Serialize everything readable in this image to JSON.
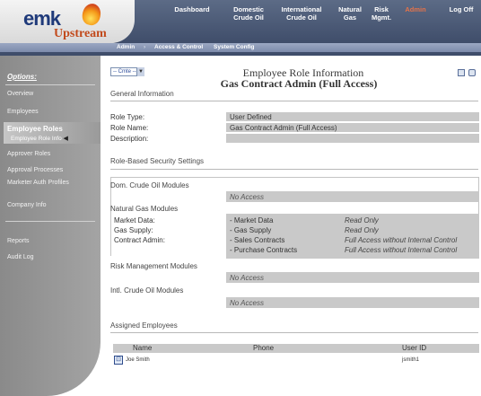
{
  "logo": {
    "brand": "emk",
    "product": "Upstream"
  },
  "topnav": [
    {
      "label": "Dashboard"
    },
    {
      "label": "Domestic Crude Oil"
    },
    {
      "label": "International Crude Oil"
    },
    {
      "label": "Natural Gas"
    },
    {
      "label": "Risk Mgmt."
    },
    {
      "label": "Admin"
    },
    {
      "label": "Log Off"
    }
  ],
  "subnav": [
    {
      "label": "Admin"
    },
    {
      "label": "Access & Control"
    },
    {
      "label": "System Config"
    }
  ],
  "sidebar": {
    "heading": "Options:",
    "items": [
      {
        "label": "Overview"
      },
      {
        "label": "Employees"
      },
      {
        "label": "Employee Roles"
      },
      {
        "label": "Employee Role Info"
      },
      {
        "label": "Approver Roles"
      },
      {
        "label": "Approval Processes"
      },
      {
        "label": "Marketer Auth Profiles"
      },
      {
        "label": "Company Info"
      },
      {
        "label": "Reports"
      },
      {
        "label": "Audit Log"
      }
    ]
  },
  "crude_select": {
    "value": "-- Cmte --"
  },
  "page": {
    "title": "Employee Role Information",
    "subtitle": "Gas Contract Admin (Full Access)"
  },
  "general": {
    "heading": "General Information",
    "role_type_label": "Role Type:",
    "role_type_value": "User Defined",
    "role_name_label": "Role Name:",
    "role_name_value": "Gas Contract Admin (Full Access)",
    "description_label": "Description:",
    "description_value": ""
  },
  "security": {
    "heading": "Role-Based Security Settings",
    "dom_crude": {
      "heading": "Dom. Crude Oil Modules",
      "value": "No Access"
    },
    "nat_gas": {
      "heading": "Natural Gas Modules",
      "rows": [
        {
          "label": "Market Data:",
          "module": "- Market Data",
          "access": "Read Only"
        },
        {
          "label": "Gas Supply:",
          "module": "- Gas Supply",
          "access": "Read Only"
        },
        {
          "label": "Contract Admin:",
          "module": "- Sales Contracts",
          "access": "Full Access without Internal Control"
        },
        {
          "label": "",
          "module": "- Purchase Contracts",
          "access": "Full Access without Internal Control"
        }
      ]
    },
    "risk": {
      "heading": "Risk Management Modules",
      "value": "No Access"
    },
    "intl": {
      "heading": "Intl. Crude Oil Modules",
      "value": "No Access"
    }
  },
  "assigned": {
    "heading": "Assigned Employees",
    "columns": [
      "Name",
      "Phone",
      "User ID"
    ],
    "rows": [
      {
        "name": "Joe Smith",
        "phone": "",
        "user_id": "jsmith1"
      }
    ]
  },
  "colors": {
    "header_bg": "#4a5877",
    "admin_active": "#e5734a",
    "sidebar_bg": "#999999",
    "value_bar": "#c9c9c9",
    "upstream_text": "#c24a1c",
    "logo_text": "#1f3a7a"
  }
}
